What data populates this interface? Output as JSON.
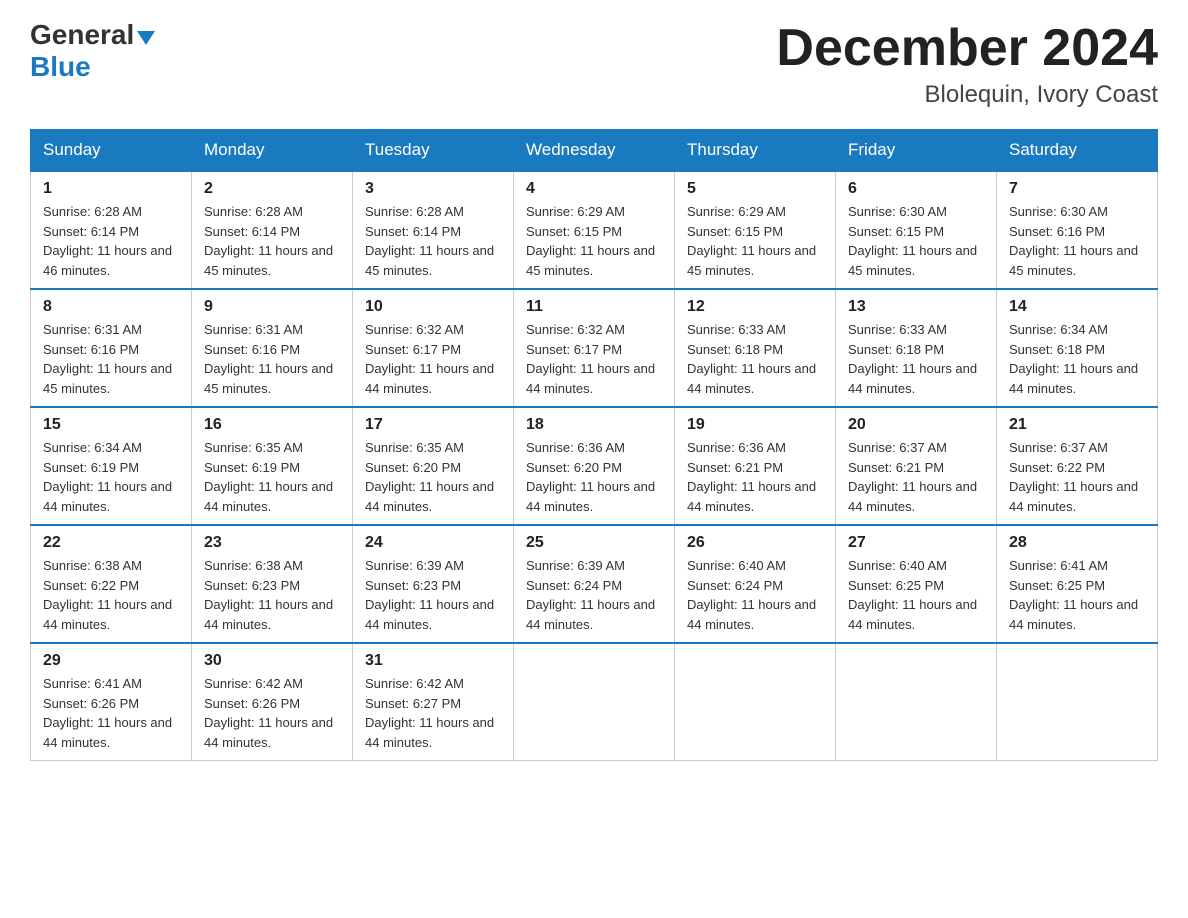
{
  "logo": {
    "general": "General",
    "blue": "Blue",
    "triangle": "▶"
  },
  "title": "December 2024",
  "subtitle": "Blolequin, Ivory Coast",
  "header_days": [
    "Sunday",
    "Monday",
    "Tuesday",
    "Wednesday",
    "Thursday",
    "Friday",
    "Saturday"
  ],
  "weeks": [
    [
      {
        "day": "1",
        "sunrise": "6:28 AM",
        "sunset": "6:14 PM",
        "daylight": "11 hours and 46 minutes."
      },
      {
        "day": "2",
        "sunrise": "6:28 AM",
        "sunset": "6:14 PM",
        "daylight": "11 hours and 45 minutes."
      },
      {
        "day": "3",
        "sunrise": "6:28 AM",
        "sunset": "6:14 PM",
        "daylight": "11 hours and 45 minutes."
      },
      {
        "day": "4",
        "sunrise": "6:29 AM",
        "sunset": "6:15 PM",
        "daylight": "11 hours and 45 minutes."
      },
      {
        "day": "5",
        "sunrise": "6:29 AM",
        "sunset": "6:15 PM",
        "daylight": "11 hours and 45 minutes."
      },
      {
        "day": "6",
        "sunrise": "6:30 AM",
        "sunset": "6:15 PM",
        "daylight": "11 hours and 45 minutes."
      },
      {
        "day": "7",
        "sunrise": "6:30 AM",
        "sunset": "6:16 PM",
        "daylight": "11 hours and 45 minutes."
      }
    ],
    [
      {
        "day": "8",
        "sunrise": "6:31 AM",
        "sunset": "6:16 PM",
        "daylight": "11 hours and 45 minutes."
      },
      {
        "day": "9",
        "sunrise": "6:31 AM",
        "sunset": "6:16 PM",
        "daylight": "11 hours and 45 minutes."
      },
      {
        "day": "10",
        "sunrise": "6:32 AM",
        "sunset": "6:17 PM",
        "daylight": "11 hours and 44 minutes."
      },
      {
        "day": "11",
        "sunrise": "6:32 AM",
        "sunset": "6:17 PM",
        "daylight": "11 hours and 44 minutes."
      },
      {
        "day": "12",
        "sunrise": "6:33 AM",
        "sunset": "6:18 PM",
        "daylight": "11 hours and 44 minutes."
      },
      {
        "day": "13",
        "sunrise": "6:33 AM",
        "sunset": "6:18 PM",
        "daylight": "11 hours and 44 minutes."
      },
      {
        "day": "14",
        "sunrise": "6:34 AM",
        "sunset": "6:18 PM",
        "daylight": "11 hours and 44 minutes."
      }
    ],
    [
      {
        "day": "15",
        "sunrise": "6:34 AM",
        "sunset": "6:19 PM",
        "daylight": "11 hours and 44 minutes."
      },
      {
        "day": "16",
        "sunrise": "6:35 AM",
        "sunset": "6:19 PM",
        "daylight": "11 hours and 44 minutes."
      },
      {
        "day": "17",
        "sunrise": "6:35 AM",
        "sunset": "6:20 PM",
        "daylight": "11 hours and 44 minutes."
      },
      {
        "day": "18",
        "sunrise": "6:36 AM",
        "sunset": "6:20 PM",
        "daylight": "11 hours and 44 minutes."
      },
      {
        "day": "19",
        "sunrise": "6:36 AM",
        "sunset": "6:21 PM",
        "daylight": "11 hours and 44 minutes."
      },
      {
        "day": "20",
        "sunrise": "6:37 AM",
        "sunset": "6:21 PM",
        "daylight": "11 hours and 44 minutes."
      },
      {
        "day": "21",
        "sunrise": "6:37 AM",
        "sunset": "6:22 PM",
        "daylight": "11 hours and 44 minutes."
      }
    ],
    [
      {
        "day": "22",
        "sunrise": "6:38 AM",
        "sunset": "6:22 PM",
        "daylight": "11 hours and 44 minutes."
      },
      {
        "day": "23",
        "sunrise": "6:38 AM",
        "sunset": "6:23 PM",
        "daylight": "11 hours and 44 minutes."
      },
      {
        "day": "24",
        "sunrise": "6:39 AM",
        "sunset": "6:23 PM",
        "daylight": "11 hours and 44 minutes."
      },
      {
        "day": "25",
        "sunrise": "6:39 AM",
        "sunset": "6:24 PM",
        "daylight": "11 hours and 44 minutes."
      },
      {
        "day": "26",
        "sunrise": "6:40 AM",
        "sunset": "6:24 PM",
        "daylight": "11 hours and 44 minutes."
      },
      {
        "day": "27",
        "sunrise": "6:40 AM",
        "sunset": "6:25 PM",
        "daylight": "11 hours and 44 minutes."
      },
      {
        "day": "28",
        "sunrise": "6:41 AM",
        "sunset": "6:25 PM",
        "daylight": "11 hours and 44 minutes."
      }
    ],
    [
      {
        "day": "29",
        "sunrise": "6:41 AM",
        "sunset": "6:26 PM",
        "daylight": "11 hours and 44 minutes."
      },
      {
        "day": "30",
        "sunrise": "6:42 AM",
        "sunset": "6:26 PM",
        "daylight": "11 hours and 44 minutes."
      },
      {
        "day": "31",
        "sunrise": "6:42 AM",
        "sunset": "6:27 PM",
        "daylight": "11 hours and 44 minutes."
      },
      null,
      null,
      null,
      null
    ]
  ]
}
